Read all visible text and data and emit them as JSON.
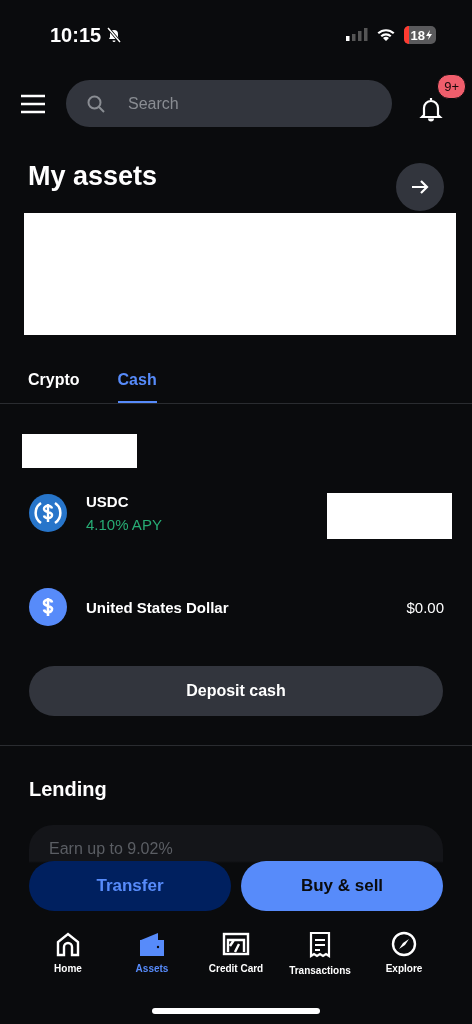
{
  "status_bar": {
    "time": "10:15",
    "battery": "18"
  },
  "header": {
    "search": {
      "placeholder": "Search"
    },
    "notifications_badge": "9+"
  },
  "title": "My assets",
  "tabs": [
    {
      "label": "Crypto",
      "selected": false
    },
    {
      "label": "Cash",
      "selected": true
    }
  ],
  "assets": [
    {
      "kind": "usdc",
      "name": "USDC",
      "subtitle": "4.10% APY"
    },
    {
      "kind": "usd",
      "name": "United States Dollar",
      "amount": "$0.00"
    }
  ],
  "deposit_button": "Deposit cash",
  "lending": {
    "title": "Lending",
    "card_text": "Earn up to 9.02%"
  },
  "actions": [
    {
      "label": "Transfer",
      "kind": "secondary"
    },
    {
      "label": "Buy & sell",
      "kind": "primary"
    }
  ],
  "nav": [
    {
      "label": "Home",
      "selected": false
    },
    {
      "label": "Assets",
      "selected": true
    },
    {
      "label": "Credit Card",
      "selected": false
    },
    {
      "label": "Transactions",
      "selected": false
    },
    {
      "label": "Explore",
      "selected": false
    }
  ]
}
